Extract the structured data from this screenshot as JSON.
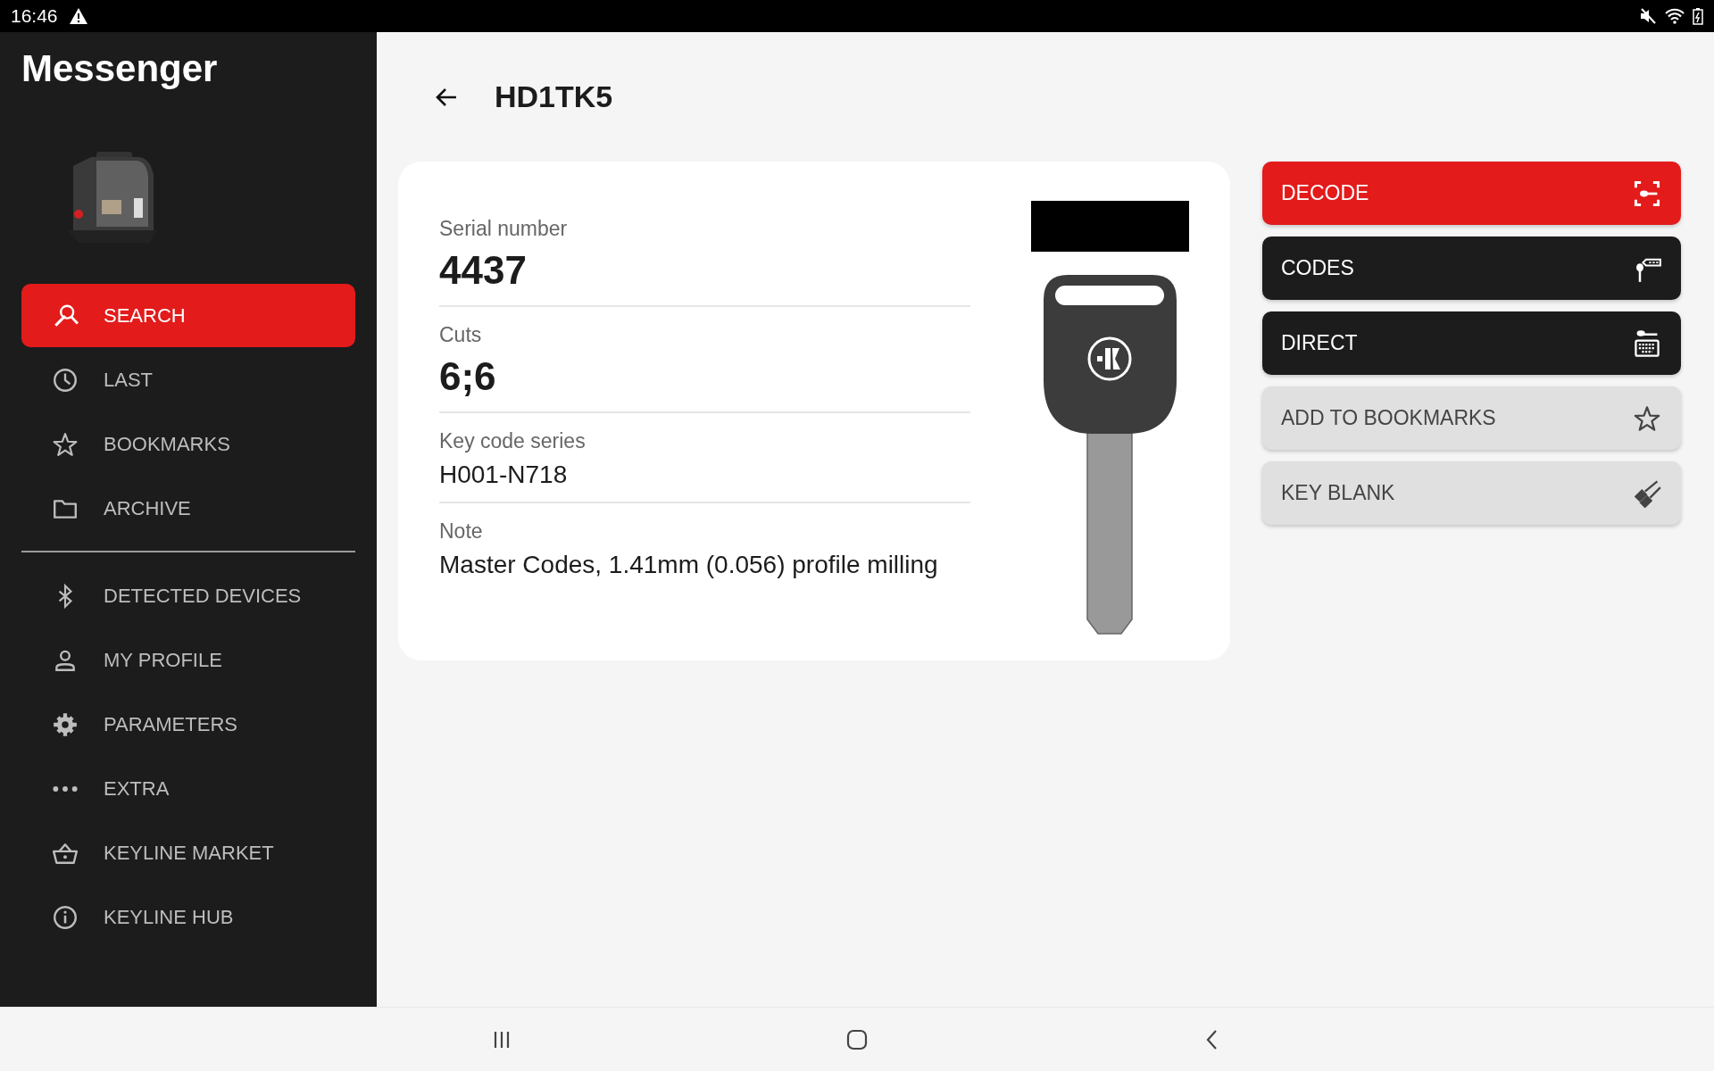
{
  "status_bar": {
    "time": "16:46"
  },
  "sidebar": {
    "app_title": "Messenger",
    "sections": [
      [
        {
          "label": "SEARCH",
          "selected": true
        },
        {
          "label": "LAST",
          "selected": false
        },
        {
          "label": "BOOKMARKS",
          "selected": false
        },
        {
          "label": "ARCHIVE",
          "selected": false
        }
      ],
      [
        {
          "label": "DETECTED DEVICES",
          "selected": false
        },
        {
          "label": "MY PROFILE",
          "selected": false
        },
        {
          "label": "PARAMETERS",
          "selected": false
        },
        {
          "label": "EXTRA",
          "selected": false
        },
        {
          "label": "KEYLINE MARKET",
          "selected": false
        },
        {
          "label": "KEYLINE HUB",
          "selected": false
        }
      ]
    ]
  },
  "header": {
    "title": "HD1TK5"
  },
  "details": [
    {
      "label": "Serial number",
      "value": "4437",
      "kind": "large"
    },
    {
      "label": "Cuts",
      "value": "6;6",
      "kind": "large"
    },
    {
      "label": "Key code series",
      "value": "H001-N718",
      "kind": "normal"
    },
    {
      "label": "Note",
      "value": "Master Codes, 1.41mm (0.056) profile milling",
      "kind": "normal"
    }
  ],
  "actions": [
    {
      "label": "DECODE",
      "kind": "primary"
    },
    {
      "label": "CODES",
      "kind": "dark"
    },
    {
      "label": "DIRECT",
      "kind": "dark"
    },
    {
      "label": "ADD TO BOOKMARKS",
      "kind": "light"
    },
    {
      "label": "KEY BLANK",
      "kind": "light"
    }
  ]
}
